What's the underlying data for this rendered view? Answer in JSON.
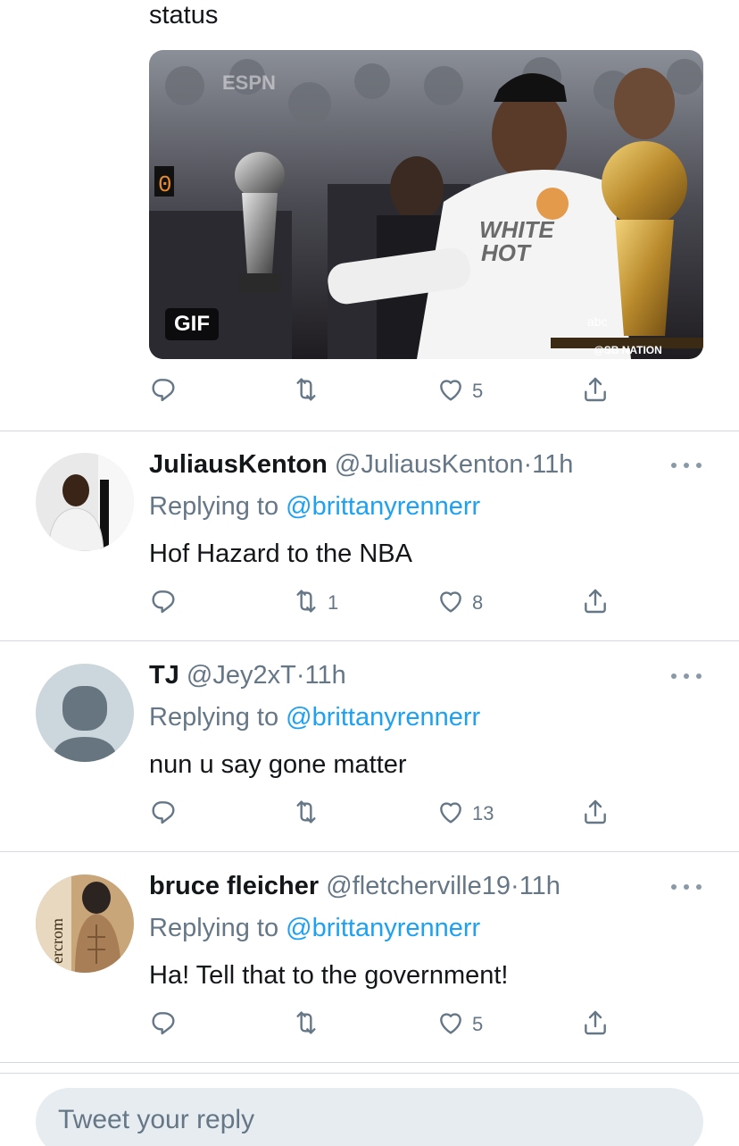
{
  "top_tweet": {
    "text_tail": "status",
    "media_badge": "GIF",
    "media_captions": {
      "shirt_line1": "WHITE",
      "shirt_line2": "HOT",
      "network": "abc",
      "watermark": "@SB NATION"
    },
    "actions": {
      "reply": "",
      "retweet": "",
      "like": "5",
      "share": ""
    }
  },
  "replies": [
    {
      "display_name": "JuliausKenton",
      "handle": "@JuliausKenton",
      "dot": "·",
      "time": "11h",
      "replying_label": "Replying to ",
      "replying_to": "@brittanyrennerr",
      "text": "Hof Hazard to the NBA",
      "actions": {
        "reply": "",
        "retweet": "1",
        "like": "8",
        "share": ""
      }
    },
    {
      "display_name": "TJ",
      "handle": "@Jey2xT",
      "dot": "·",
      "time": "11h",
      "replying_label": "Replying to ",
      "replying_to": "@brittanyrennerr",
      "text": "nun u say gone matter",
      "actions": {
        "reply": "",
        "retweet": "",
        "like": "13",
        "share": ""
      }
    },
    {
      "display_name": "bruce fleicher",
      "handle": "@fletcherville19",
      "dot": "·",
      "time": "11h",
      "replying_label": "Replying to ",
      "replying_to": "@brittanyrennerr",
      "text": "Ha! Tell that to the government!",
      "avatar_text": "ercrom",
      "actions": {
        "reply": "",
        "retweet": "",
        "like": "5",
        "share": ""
      }
    }
  ],
  "reply_box": {
    "placeholder": "Tweet your reply"
  },
  "colors": {
    "text": "#14171a",
    "secondary": "#657786",
    "link": "#1da1f2",
    "divider": "#d4d9de",
    "input_bg": "#e6ecf0"
  },
  "icons": [
    "reply-icon",
    "retweet-icon",
    "like-icon",
    "share-icon",
    "more-icon"
  ]
}
